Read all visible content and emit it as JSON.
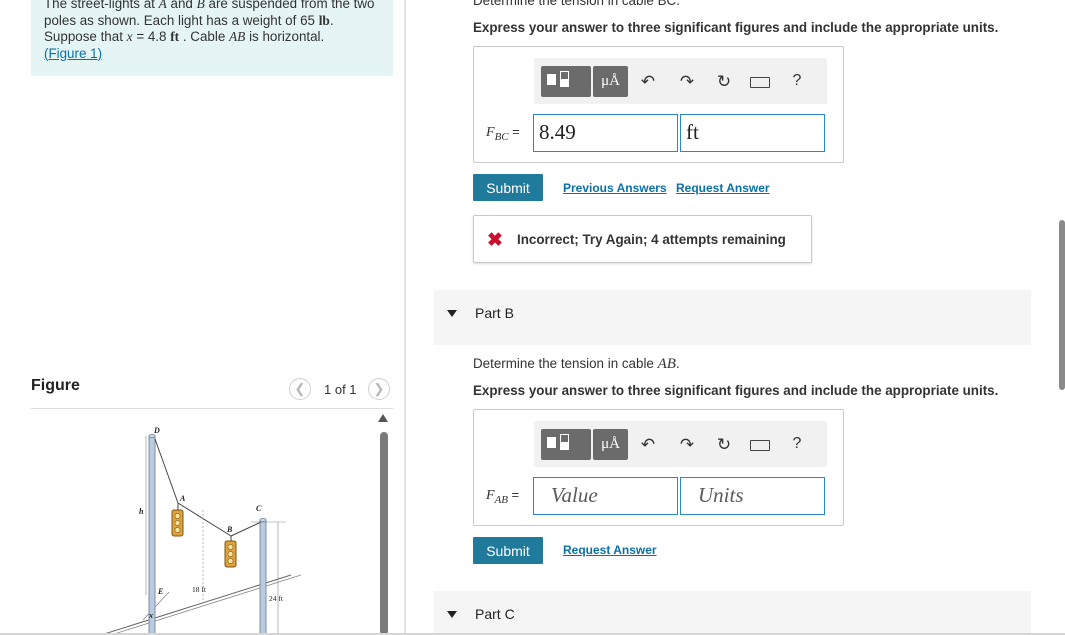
{
  "problem": {
    "line1": "The street-lights at ",
    "point_a": "A",
    "line1b": " and ",
    "point_b": "B",
    "line1c": " are suspended from the two poles as shown. Each light has a weight of 65 ",
    "weight_unit": "lb",
    "line2": ". Suppose that ",
    "x_var": "x",
    "line2b": " = 4.8 ",
    "x_unit": "ft",
    "line2c": " . Cable ",
    "cable": "AB",
    "line2d": " is horizontal.",
    "figure_link": "(Figure 1)"
  },
  "figure": {
    "heading": "Figure",
    "counter": "1 of 1",
    "labels": {
      "D": "D",
      "A": "A",
      "C": "C",
      "B": "B",
      "E": "E",
      "h": "h",
      "x": "x",
      "dim18": "18 ft",
      "dim24": "24 ft"
    }
  },
  "part_a": {
    "top_prompt": "Determine the tension in cable BC.",
    "instruction": "Express your answer to three significant figures and include the appropriate units.",
    "var_label": "F",
    "var_sub": "BC",
    "equals": "=",
    "value": "8.49",
    "units": "ft",
    "submit": "Submit",
    "previous_answers": "Previous Answers",
    "request_answer": "Request Answer",
    "feedback": "Incorrect; Try Again; 4 attempts remaining"
  },
  "toolbar": {
    "mu_label": "μÅ",
    "help": "?"
  },
  "part_b": {
    "title": "Part B",
    "prompt_prefix": "Determine the tension in cable ",
    "prompt_var": "AB",
    "prompt_suffix": ".",
    "instruction": "Express your answer to three significant figures and include the appropriate units.",
    "var_label": "F",
    "var_sub": "AB",
    "equals": "=",
    "value_placeholder": "Value",
    "units_placeholder": "Units",
    "submit": "Submit",
    "request_answer": "Request Answer"
  },
  "part_c": {
    "title": "Part C"
  },
  "colors": {
    "accent": "#1f7a9c",
    "link": "#0b70a8",
    "error": "#c8102e",
    "problem_bg": "#e5f5f5",
    "field_border": "#2b87c8"
  }
}
